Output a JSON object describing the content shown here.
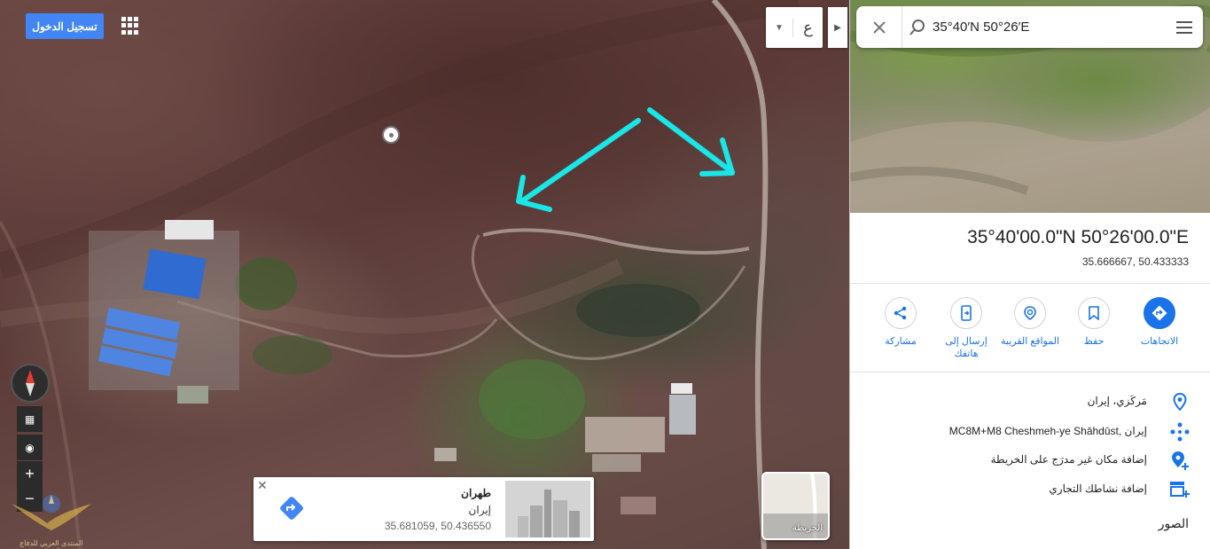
{
  "map": {
    "login_label": "تسجيل الدخول",
    "language_label": "ع",
    "apps_icon": "apps-grid-icon",
    "arrow_color": "#19e6e6",
    "place_card": {
      "title": "طهران",
      "subtitle": "إيران",
      "coords": "35.681059, 50.436550"
    },
    "layer_switch_label": "الخريطة",
    "watermark_text": "المنتدى العربي للدفاع والتسليح"
  },
  "panel": {
    "search_query": "35°40′N 50°26′E",
    "coord_title": "35°40'00.0\"N 50°26'00.0\"E",
    "coord_decimal": "35.666667, 50.433333",
    "actions": [
      {
        "label": "الاتجاهات",
        "icon": "directions-icon",
        "primary": true
      },
      {
        "label": "حفظ",
        "icon": "bookmark-icon",
        "primary": false
      },
      {
        "label": "المواقع القريبة",
        "icon": "nearby-icon",
        "primary": false
      },
      {
        "label": "إرسال إلى هاتفك",
        "icon": "send-to-phone-icon",
        "primary": false
      },
      {
        "label": "مشاركة",
        "icon": "share-icon",
        "primary": false
      }
    ],
    "info_rows": [
      {
        "text": "مَركَزي، إيران",
        "icon": "location-pin-icon"
      },
      {
        "text": "MC8M+M8 Cheshmeh-ye Shāhdūst, إيران",
        "icon": "plus-code-icon"
      },
      {
        "text": "إضافة مكان غير مدرَج على الخريطة",
        "icon": "add-place-icon"
      },
      {
        "text": "إضافة نشاطك التجاري",
        "icon": "add-business-icon"
      }
    ],
    "photos_label": "الصور",
    "accent_color": "#1a73e8"
  }
}
